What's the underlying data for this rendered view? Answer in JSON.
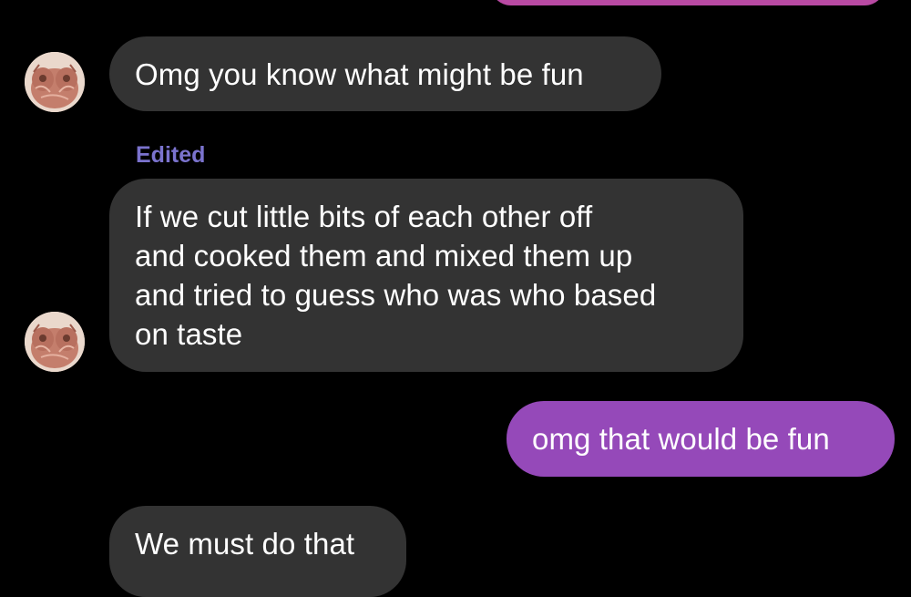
{
  "conversation": {
    "messages": [
      {
        "direction": "outgoing",
        "text": ""
      },
      {
        "direction": "incoming",
        "text": "Omg you know what might be fun"
      },
      {
        "direction": "incoming",
        "edited_label": "Edited",
        "text": "If we cut little bits of each other off\nand cooked them and mixed them up\nand tried to guess who was who based\non taste"
      },
      {
        "direction": "outgoing",
        "text": "omg that would be fun"
      },
      {
        "direction": "incoming",
        "text": "We must do that"
      }
    ]
  },
  "colors": {
    "background": "#000000",
    "incoming_bubble": "#333333",
    "outgoing_bubble": "#9549b9",
    "top_outgoing_bubble": "#b94aa3",
    "edited_label": "#7b73ce",
    "text": "#ffffff"
  },
  "icons": {
    "avatar": "owl-photo-avatar"
  }
}
